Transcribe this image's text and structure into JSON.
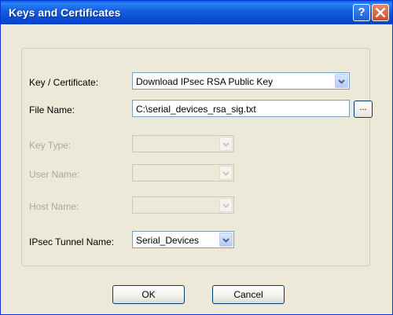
{
  "window": {
    "title": "Keys and Certificates"
  },
  "titlebar": {
    "help_label": "?"
  },
  "form": {
    "key_certificate": {
      "label": "Key / Certificate:",
      "value": "Download IPsec RSA Public Key"
    },
    "file_name": {
      "label": "File Name:",
      "value": "C:\\serial_devices_rsa_sig.txt",
      "browse_label": "..."
    },
    "key_type": {
      "label": "Key Type:",
      "value": ""
    },
    "user_name": {
      "label": "User Name:",
      "value": ""
    },
    "host_name": {
      "label": "Host Name:",
      "value": ""
    },
    "ipsec_tunnel_name": {
      "label": "IPsec Tunnel Name:",
      "value": "Serial_Devices"
    }
  },
  "buttons": {
    "ok": "OK",
    "cancel": "Cancel"
  }
}
